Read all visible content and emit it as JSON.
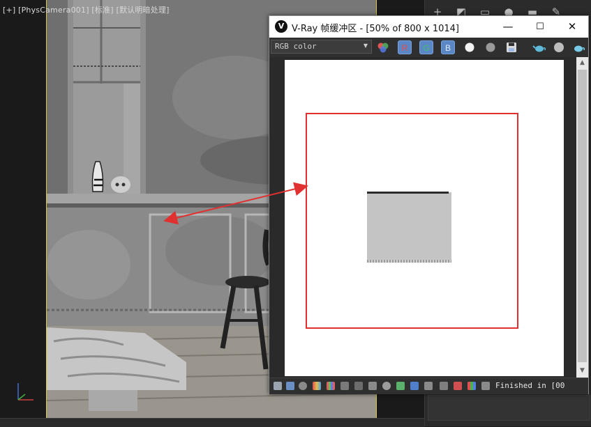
{
  "viewport": {
    "label": "[+] [PhysCamera001] [标准] [默认明暗处理]"
  },
  "vfb": {
    "logo": "V",
    "title": "V-Ray 帧缓冲区 - [50% of 800 x 1014]",
    "window_buttons": {
      "minimize": "—",
      "maximize": "☐",
      "close": "✕"
    },
    "channel": "RGB color",
    "rgb_buttons": {
      "r": "R",
      "g": "G",
      "b": "B"
    },
    "status": "Finished in [00"
  },
  "icons": {
    "color-balls": "color-balls-icon",
    "save": "save-icon",
    "teapot": "teapot-icon",
    "plus": "plus-icon",
    "wrench": "wrench-icon"
  },
  "colors": {
    "highlight_box": "#e03030",
    "rgb_button": "#5b87c7",
    "viewport_frame": "#d6c84a"
  }
}
